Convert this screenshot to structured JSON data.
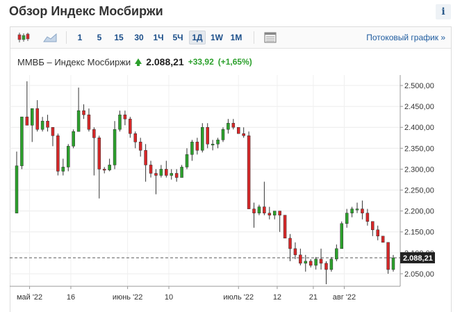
{
  "header": {
    "title": "Обзор Индекс Мосбиржи",
    "info_label": "i"
  },
  "toolbar": {
    "candle_icon": "candlestick-icon",
    "area_icon": "area-chart-icon",
    "periods": [
      {
        "label": "1",
        "active": false
      },
      {
        "label": "5",
        "active": false
      },
      {
        "label": "15",
        "active": false
      },
      {
        "label": "30",
        "active": false
      },
      {
        "label": "1Ч",
        "active": false
      },
      {
        "label": "5Ч",
        "active": false
      },
      {
        "label": "1Д",
        "active": true
      },
      {
        "label": "1W",
        "active": false
      },
      {
        "label": "1M",
        "active": false
      }
    ],
    "table_icon": "table-icon",
    "stream_link": "Потоковый график »"
  },
  "quote": {
    "name": "ММВБ – Индекс Мосбиржи",
    "price": "2.088,21",
    "change": "+33,92",
    "change_pct": "(+1,65%)"
  },
  "colors": {
    "up": "#2ca02c",
    "down": "#d62728",
    "accent": "#1c4f8a"
  },
  "chart_data": {
    "type": "candlestick",
    "ylim": [
      2020,
      2525
    ],
    "y_ticks": [
      2050,
      2100,
      2150,
      2200,
      2250,
      2300,
      2350,
      2400,
      2450,
      2500
    ],
    "y_tick_labels": [
      "2.050,00",
      "2.100,00",
      "2.150,00",
      "2.200,00",
      "2.250,00",
      "2.300,00",
      "2.350,00",
      "2.400,00",
      "2.450,00",
      "2.500,00"
    ],
    "x_labels": [
      {
        "label": "май '22",
        "index": 2.5
      },
      {
        "label": "16",
        "index": 10.5
      },
      {
        "label": "июнь '22",
        "index": 21.5
      },
      {
        "label": "10",
        "index": 29.5
      },
      {
        "label": "июль '22",
        "index": 43
      },
      {
        "label": "12",
        "index": 50.5
      },
      {
        "label": "21",
        "index": 57.5
      },
      {
        "label": "авг '22",
        "index": 63.5
      }
    ],
    "last_price": 2088.21,
    "last_label": "2.088,21",
    "ohlc": [
      [
        2195,
        2342,
        2195,
        2308
      ],
      [
        2308,
        2425,
        2300,
        2425
      ],
      [
        2425,
        2510,
        2425,
        2405
      ],
      [
        2405,
        2445,
        2365,
        2445
      ],
      [
        2445,
        2465,
        2390,
        2395
      ],
      [
        2395,
        2425,
        2390,
        2415
      ],
      [
        2415,
        2430,
        2390,
        2400
      ],
      [
        2400,
        2400,
        2355,
        2380
      ],
      [
        2380,
        2385,
        2285,
        2295
      ],
      [
        2295,
        2325,
        2285,
        2305
      ],
      [
        2305,
        2360,
        2295,
        2355
      ],
      [
        2355,
        2395,
        2350,
        2390
      ],
      [
        2390,
        2495,
        2390,
        2440
      ],
      [
        2440,
        2455,
        2420,
        2430
      ],
      [
        2430,
        2445,
        2390,
        2395
      ],
      [
        2395,
        2400,
        2285,
        2375
      ],
      [
        2375,
        2380,
        2230,
        2300
      ],
      [
        2300,
        2305,
        2290,
        2298
      ],
      [
        2298,
        2325,
        2295,
        2310
      ],
      [
        2310,
        2415,
        2300,
        2395
      ],
      [
        2395,
        2440,
        2390,
        2430
      ],
      [
        2430,
        2440,
        2405,
        2420
      ],
      [
        2420,
        2425,
        2375,
        2385
      ],
      [
        2385,
        2390,
        2350,
        2365
      ],
      [
        2365,
        2375,
        2330,
        2345
      ],
      [
        2345,
        2360,
        2270,
        2310
      ],
      [
        2310,
        2320,
        2280,
        2290
      ],
      [
        2290,
        2300,
        2240,
        2285
      ],
      [
        2285,
        2310,
        2280,
        2300
      ],
      [
        2300,
        2320,
        2280,
        2285
      ],
      [
        2285,
        2300,
        2275,
        2290
      ],
      [
        2290,
        2300,
        2270,
        2280
      ],
      [
        2280,
        2310,
        2280,
        2305
      ],
      [
        2305,
        2350,
        2300,
        2335
      ],
      [
        2335,
        2370,
        2320,
        2365
      ],
      [
        2365,
        2375,
        2335,
        2345
      ],
      [
        2345,
        2410,
        2340,
        2400
      ],
      [
        2400,
        2410,
        2350,
        2360
      ],
      [
        2360,
        2370,
        2345,
        2360
      ],
      [
        2360,
        2375,
        2350,
        2370
      ],
      [
        2370,
        2400,
        2365,
        2395
      ],
      [
        2395,
        2420,
        2385,
        2410
      ],
      [
        2410,
        2420,
        2395,
        2400
      ],
      [
        2400,
        2400,
        2385,
        2385
      ],
      [
        2385,
        2400,
        2375,
        2380
      ],
      [
        2380,
        2390,
        2215,
        2205
      ],
      [
        2205,
        2220,
        2160,
        2195
      ],
      [
        2195,
        2215,
        2190,
        2210
      ],
      [
        2210,
        2270,
        2190,
        2195
      ],
      [
        2195,
        2210,
        2180,
        2190
      ],
      [
        2190,
        2200,
        2180,
        2200
      ],
      [
        2200,
        2200,
        2150,
        2190
      ],
      [
        2190,
        2190,
        2145,
        2135
      ],
      [
        2135,
        2145,
        2080,
        2110
      ],
      [
        2110,
        2125,
        2085,
        2095
      ],
      [
        2095,
        2110,
        2070,
        2075
      ],
      [
        2075,
        2095,
        2055,
        2080
      ],
      [
        2080,
        2085,
        2065,
        2070
      ],
      [
        2070,
        2090,
        2060,
        2085
      ],
      [
        2085,
        2110,
        2060,
        2075
      ],
      [
        2075,
        2080,
        2025,
        2060
      ],
      [
        2060,
        2090,
        2055,
        2085
      ],
      [
        2085,
        2120,
        2080,
        2110
      ],
      [
        2110,
        2175,
        2110,
        2170
      ],
      [
        2170,
        2205,
        2160,
        2195
      ],
      [
        2195,
        2210,
        2185,
        2205
      ],
      [
        2205,
        2220,
        2195,
        2205
      ],
      [
        2205,
        2225,
        2180,
        2195
      ],
      [
        2195,
        2205,
        2165,
        2175
      ],
      [
        2175,
        2175,
        2140,
        2155
      ],
      [
        2155,
        2165,
        2130,
        2140
      ],
      [
        2140,
        2140,
        2130,
        2125
      ],
      [
        2125,
        2125,
        2050,
        2060
      ],
      [
        2060,
        2095,
        2055,
        2088
      ]
    ]
  }
}
